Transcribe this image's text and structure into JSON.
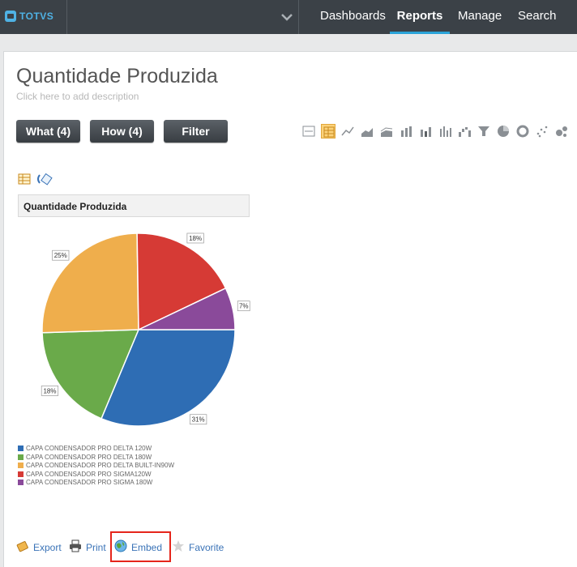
{
  "brand": {
    "logo_text": "TOTVS"
  },
  "nav": {
    "items": [
      {
        "label": "Dashboards"
      },
      {
        "label": "Reports"
      },
      {
        "label": "Manage"
      },
      {
        "label": "Search"
      }
    ]
  },
  "report": {
    "title": "Quantidade Produzida",
    "description_placeholder": "Click here to add description"
  },
  "toolbar": {
    "what_label": "What (4)",
    "how_label": "How (4)",
    "filter_label": "Filter"
  },
  "chart_types": {
    "selected": "table",
    "icons": [
      "number-icon",
      "table-icon",
      "line-chart-icon",
      "area-chart-icon",
      "stacked-area-icon",
      "bar-chart-icon",
      "stacked-bar-icon",
      "column-chart-icon",
      "waterfall-icon",
      "funnel-icon",
      "pie-chart-icon",
      "donut-chart-icon",
      "scatter-icon",
      "bubble-icon"
    ]
  },
  "chart_data": {
    "type": "pie",
    "title": "Quantidade Produzida",
    "slices": [
      {
        "label": "CAPA CONDENSADOR PRO DELTA 120W",
        "value": 31,
        "display": "31%",
        "color": "#2e6db4"
      },
      {
        "label": "CAPA CONDENSADOR PRO DELTA 180W",
        "value": 18,
        "display": "18%",
        "color": "#6aaa4a"
      },
      {
        "label": "CAPA CONDENSADOR PRO DELTA BUILT-IN90W",
        "value": 25,
        "display": "25%",
        "color": "#efae4c"
      },
      {
        "label": "CAPA CONDENSADOR PRO SIGMA120W",
        "value": 18,
        "display": "18%",
        "color": "#d63a35"
      },
      {
        "label": "CAPA CONDENSADOR PRO SIGMA 180W",
        "value": 7,
        "display": "7%",
        "color": "#8a4a9a"
      }
    ],
    "legend_position": "bottom"
  },
  "actions": {
    "export_label": "Export",
    "print_label": "Print",
    "embed_label": "Embed",
    "favorite_label": "Favorite"
  }
}
